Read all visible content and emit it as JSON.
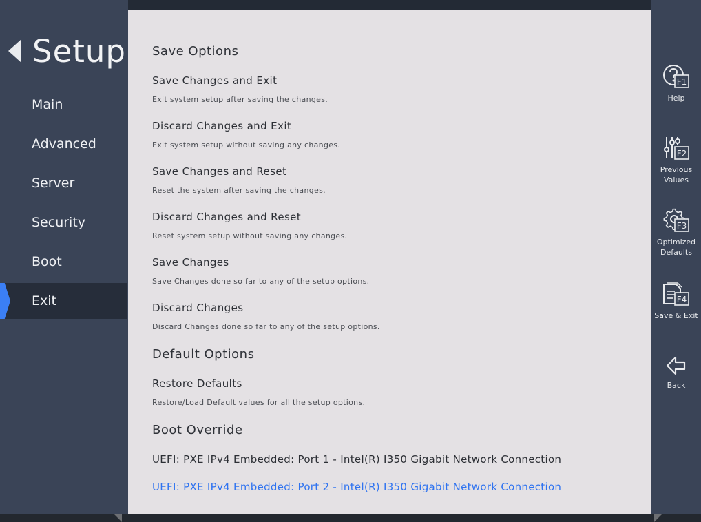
{
  "nav": {
    "title": "Setup",
    "items": [
      {
        "label": "Main"
      },
      {
        "label": "Advanced"
      },
      {
        "label": "Server"
      },
      {
        "label": "Security"
      },
      {
        "label": "Boot"
      },
      {
        "label": "Exit"
      }
    ],
    "active": "Exit"
  },
  "save_options": {
    "title": "Save Options",
    "items": [
      {
        "label": "Save Changes and Exit",
        "desc": "Exit system setup after saving the changes."
      },
      {
        "label": "Discard Changes and Exit",
        "desc": "Exit system setup without saving any changes."
      },
      {
        "label": "Save Changes and Reset",
        "desc": "Reset the system after saving the changes."
      },
      {
        "label": "Discard Changes and Reset",
        "desc": "Reset system setup without saving any changes."
      },
      {
        "label": "Save Changes",
        "desc": "Save Changes done so far to any of the setup options."
      },
      {
        "label": "Discard Changes",
        "desc": "Discard Changes done so far to any of the setup options."
      }
    ]
  },
  "default_options": {
    "title": "Default Options",
    "items": [
      {
        "label": "Restore Defaults",
        "desc": "Restore/Load Default values for all the setup options."
      }
    ]
  },
  "boot_override": {
    "title": "Boot Override",
    "items": [
      {
        "label": "UEFI: PXE IPv4 Embedded: Port 1 - Intel(R) I350 Gigabit Network Connection"
      },
      {
        "label": "UEFI: PXE IPv4 Embedded: Port 2 - Intel(R) I350 Gigabit Network Connection"
      }
    ],
    "selected_index": 1
  },
  "toolbar": {
    "items": [
      {
        "key": "F1",
        "label": "Help",
        "icon": "help-icon"
      },
      {
        "key": "F2",
        "label": "Previous\nValues",
        "icon": "sliders-icon"
      },
      {
        "key": "F3",
        "label": "Optimized\nDefaults",
        "icon": "gear-icon"
      },
      {
        "key": "F4",
        "label": "Save & Exit",
        "icon": "save-document-icon"
      },
      {
        "key": "",
        "label": "Back",
        "icon": "back-arrow-icon"
      }
    ]
  },
  "colors": {
    "sidebar": "#3a4457",
    "content_bg": "#e4e1e4",
    "accent": "#3b7ff5",
    "selected_text": "#2f73f0"
  }
}
